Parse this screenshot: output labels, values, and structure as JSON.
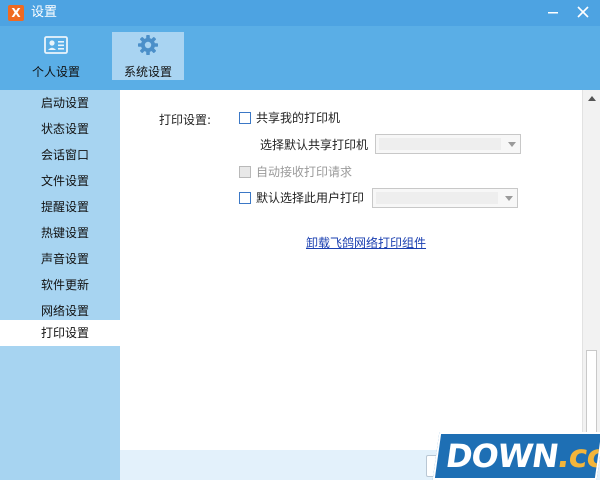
{
  "window": {
    "title": "设置",
    "app_logo_glyph": "X"
  },
  "top_tabs": [
    {
      "label": "个人设置",
      "icon": "contact-card-icon",
      "active": false
    },
    {
      "label": "系统设置",
      "icon": "gear-icon",
      "active": true
    }
  ],
  "sidebar": {
    "items": [
      {
        "label": "启动设置"
      },
      {
        "label": "状态设置"
      },
      {
        "label": "会话窗口"
      },
      {
        "label": "文件设置"
      },
      {
        "label": "提醒设置"
      },
      {
        "label": "热键设置"
      },
      {
        "label": "声音设置"
      },
      {
        "label": "软件更新"
      },
      {
        "label": "网络设置"
      },
      {
        "label": "打印设置",
        "active": true
      }
    ]
  },
  "print_settings": {
    "section_label": "打印设置:",
    "share_printer": {
      "label": "共享我的打印机",
      "checked": false
    },
    "default_share_label": "选择默认共享打印机",
    "default_share_select": {
      "value": ""
    },
    "auto_accept": {
      "label": "自动接收打印请求",
      "checked": false,
      "disabled": true
    },
    "default_user_print": {
      "label": "默认选择此用户打印",
      "checked": false
    },
    "default_user_select": {
      "value": ""
    },
    "uninstall_link": "卸载飞鸽网络打印组件"
  },
  "watermark": {
    "text": "DOWN",
    "tld": ".cc"
  },
  "colors": {
    "titlebar": "#4da3e2",
    "header": "#5aaee6",
    "sidebar": "#a7d4f1",
    "link": "#1a3fb0"
  }
}
